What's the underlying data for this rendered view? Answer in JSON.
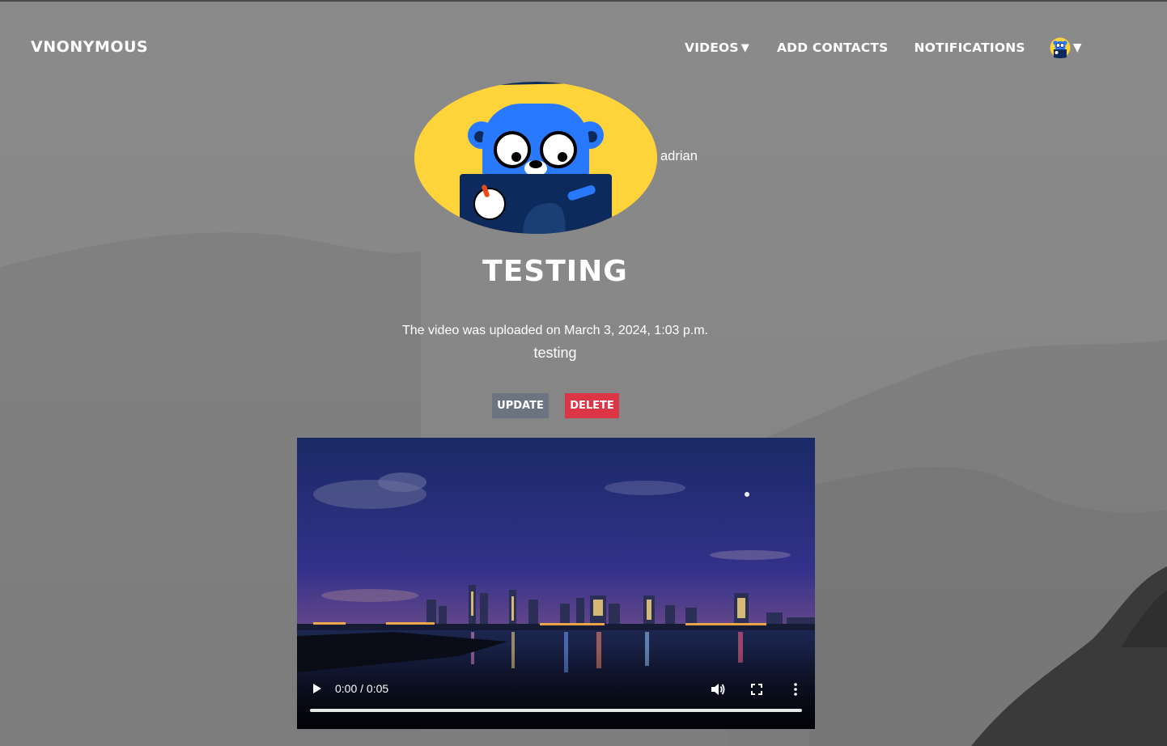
{
  "app": {
    "brand": "VNONYMOUS"
  },
  "nav": {
    "videos_label": "VIDEOS",
    "add_contacts_label": "ADD CONTACTS",
    "notifications_label": "NOTIFICATIONS",
    "dropdown_caret": "▼",
    "user_icon": "gopher-avatar-icon"
  },
  "profile": {
    "username": "adrian",
    "avatar_icon": "gopher-avatar-icon"
  },
  "video": {
    "title": "TESTING",
    "uploaded_text": "The video was uploaded on March 3, 2024, 1:03 p.m.",
    "description": "testing",
    "update_label": "UPDATE",
    "delete_label": "DELETE",
    "time_display": "0:00 / 0:05",
    "progress": 0
  },
  "colors": {
    "update_button": "#6b7480",
    "delete_button": "#dc3545",
    "avatar_yellow": "#ffd43b",
    "gopher_blue": "#2979ff",
    "laptop_navy": "#0d2a5c"
  }
}
